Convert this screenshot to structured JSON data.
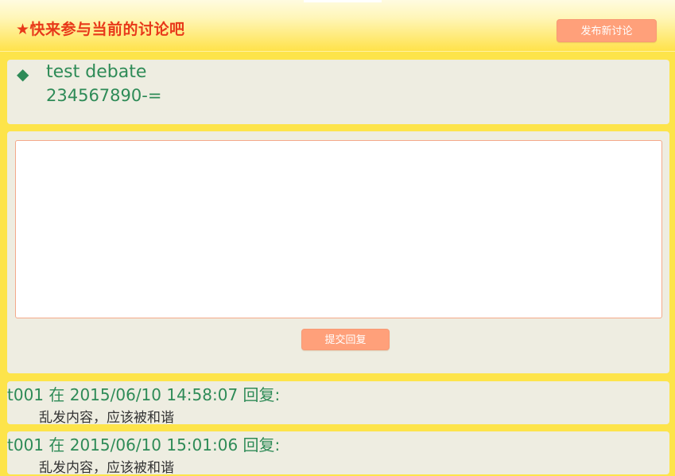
{
  "header": {
    "title": "★快来参与当前的讨论吧",
    "new_discussion_label": "发布新讨论"
  },
  "topic": {
    "title": "test debate",
    "body": "234567890-="
  },
  "reply_form": {
    "textarea_value": "",
    "submit_label": "提交回复"
  },
  "replies": [
    {
      "meta": "t001 在 2015/06/10 14:58:07 回复:",
      "content": "乱发内容，应该被和谐"
    },
    {
      "meta": "t001 在 2015/06/10 15:01:06 回复:",
      "content": "乱发内容，应该被和谐"
    }
  ],
  "icons": {
    "topic_bullet": "diamond-icon"
  },
  "colors": {
    "background": "#fde44a",
    "accent_button": "#ffa07a",
    "title_red": "#e8391a",
    "text_green": "#2e8b57",
    "panel": "#eeede1"
  }
}
